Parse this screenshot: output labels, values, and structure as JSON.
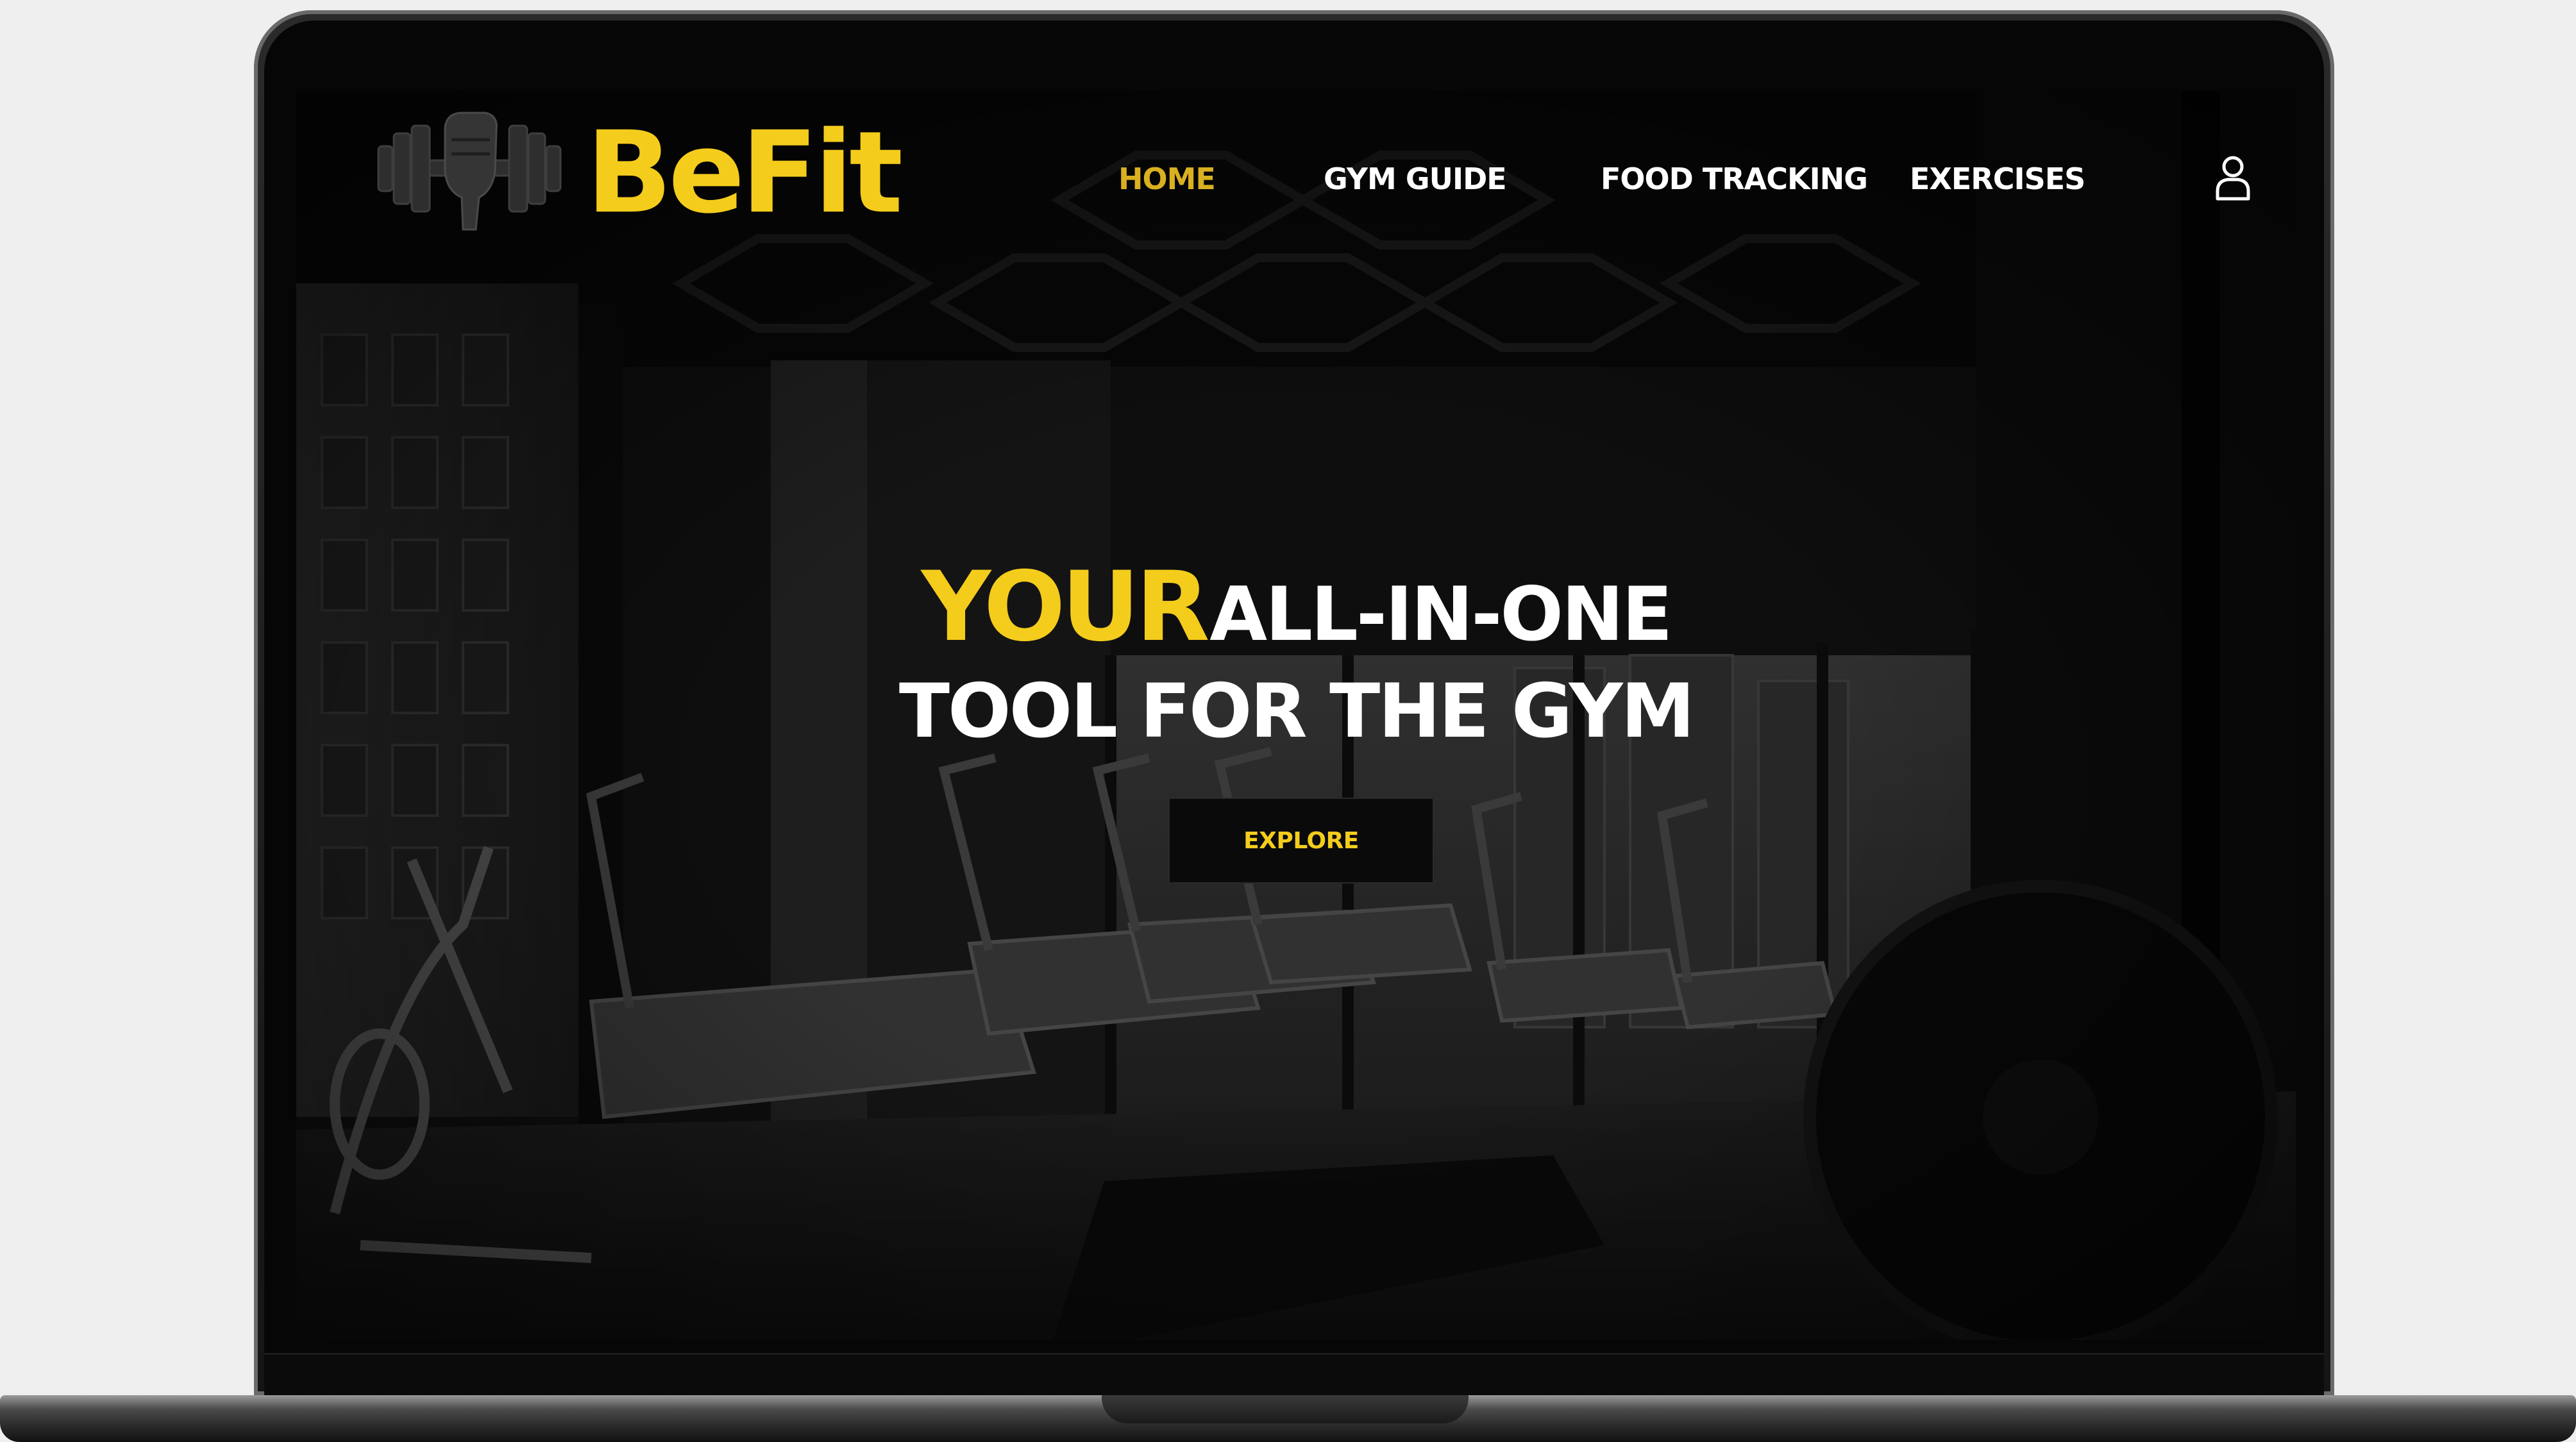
{
  "brand": {
    "name": "BeFit",
    "icon": "dumbbell-fist-icon",
    "color": "#f4cc1c"
  },
  "nav": {
    "items": [
      {
        "label": "HOME",
        "active": true
      },
      {
        "label": "GYM GUIDE",
        "active": false
      },
      {
        "label": "FOOD TRACKING",
        "active": false
      },
      {
        "label": "EXERCISES",
        "active": false
      }
    ],
    "active_color": "#d9b020",
    "user_icon": "user-icon"
  },
  "hero": {
    "headline_accent": "YOUR",
    "headline_rest": "ALL-IN-ONE",
    "headline_line2": "TOOL FOR THE GYM",
    "cta_label": "EXPLORE",
    "accent_color": "#f4cc1c"
  }
}
